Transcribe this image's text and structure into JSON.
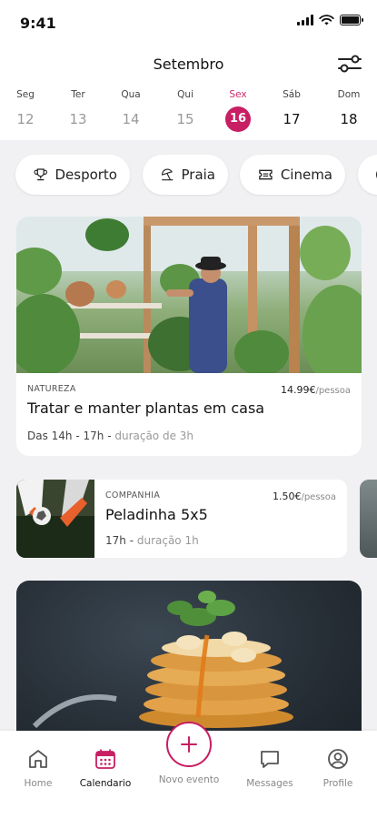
{
  "status": {
    "time": "9:41",
    "battery_level": 1.0
  },
  "header": {
    "month": "Setembro",
    "filter_icon": "filter-sliders-icon"
  },
  "week": [
    {
      "name": "Seg",
      "num": "12",
      "state": "past"
    },
    {
      "name": "Ter",
      "num": "13",
      "state": "past"
    },
    {
      "name": "Qua",
      "num": "14",
      "state": "past"
    },
    {
      "name": "Qui",
      "num": "15",
      "state": "past"
    },
    {
      "name": "Sex",
      "num": "16",
      "state": "selected"
    },
    {
      "name": "Sáb",
      "num": "17",
      "state": "future"
    },
    {
      "name": "Dom",
      "num": "18",
      "state": "future"
    }
  ],
  "categories": [
    {
      "label": "Desporto",
      "icon": "trophy-icon"
    },
    {
      "label": "Praia",
      "icon": "beach-umbrella-icon"
    },
    {
      "label": "Cinema",
      "icon": "ticket-icon"
    }
  ],
  "events": {
    "featured": {
      "category": "NATUREZA",
      "price": "14.99€",
      "price_unit": "/pessoa",
      "title": "Tratar e manter plantas em casa",
      "time": "Das 14h - 17h",
      "duration": "duração de 3h"
    },
    "second": {
      "category": "COMPANHIA",
      "price": "1.50€",
      "price_unit": "/pessoa",
      "title": "Peladinha 5x5",
      "time": "17h",
      "duration": "duração 1h"
    }
  },
  "tabbar": {
    "home": "Home",
    "calendar": "Calendario",
    "new_event": "Novo evento",
    "messages": "Messages",
    "profile": "Profile"
  },
  "colors": {
    "accent": "#c81e63",
    "background": "#f1f1f3"
  }
}
